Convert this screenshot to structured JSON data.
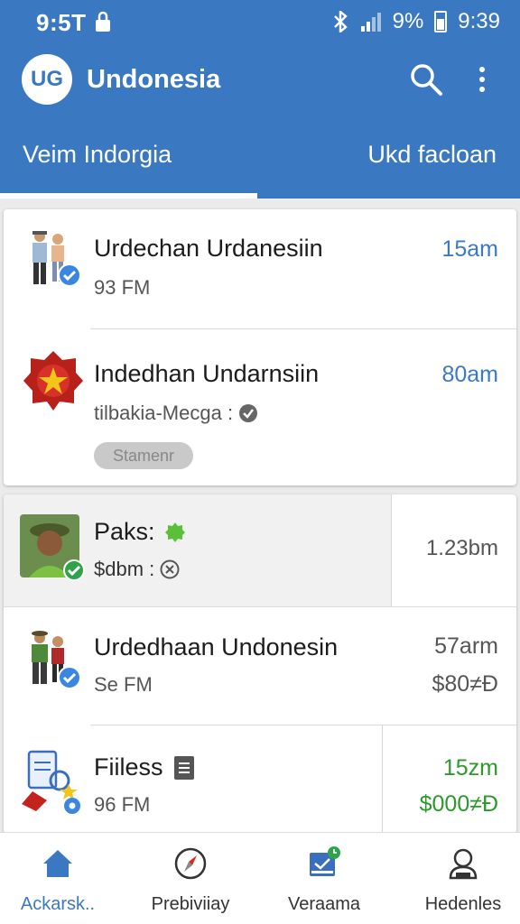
{
  "status_bar": {
    "time_left": "9:5T",
    "battery": "9%",
    "time_right": "9:39"
  },
  "app_bar": {
    "logo_text": "UG",
    "title": "Undonesia"
  },
  "tabs": [
    {
      "label": "Veim Indorgia",
      "active": true
    },
    {
      "label": "Ukd facloan",
      "active": false
    }
  ],
  "card1": {
    "items": [
      {
        "title": "Urdechan Urdanesiin",
        "subtitle": "93 FM",
        "time": "15am",
        "avatar": "people-verified-icon"
      },
      {
        "title": "Indedhan Undarnsiin",
        "subtitle": "tilbakia-Mecga :",
        "time": "80am",
        "chip": "Stamenr",
        "avatar": "star-emblem-icon"
      }
    ]
  },
  "card2": {
    "items": [
      {
        "title": "Paks:",
        "subtitle": "$dbm :",
        "time": "1.23bm",
        "avatar": "person-portrait-verified"
      },
      {
        "title": "Urdedhaan Undonesin",
        "subtitle": "Se FM",
        "time": "57arm",
        "amount": "$80≠Ɖ",
        "avatar": "people-verified-icon"
      },
      {
        "title": "Fiiless",
        "subtitle": "96 FM",
        "time": "15zm",
        "amount": "$000≠Ɖ",
        "avatar": "files-icon"
      }
    ]
  },
  "bottom_nav": [
    {
      "label": "Ackarsk..",
      "icon": "home-icon",
      "active": true
    },
    {
      "label": "Prebiviiay",
      "icon": "compass-icon",
      "active": false
    },
    {
      "label": "Veraama",
      "icon": "inbox-icon",
      "active": false
    },
    {
      "label": "Hedenles",
      "icon": "profile-icon",
      "active": false
    }
  ],
  "colors": {
    "primary": "#3a78c2",
    "time_blue": "#3a7ac4",
    "money_green": "#2a9a2a",
    "verified": "#3a86e0",
    "verified_green": "#2fa34a"
  }
}
